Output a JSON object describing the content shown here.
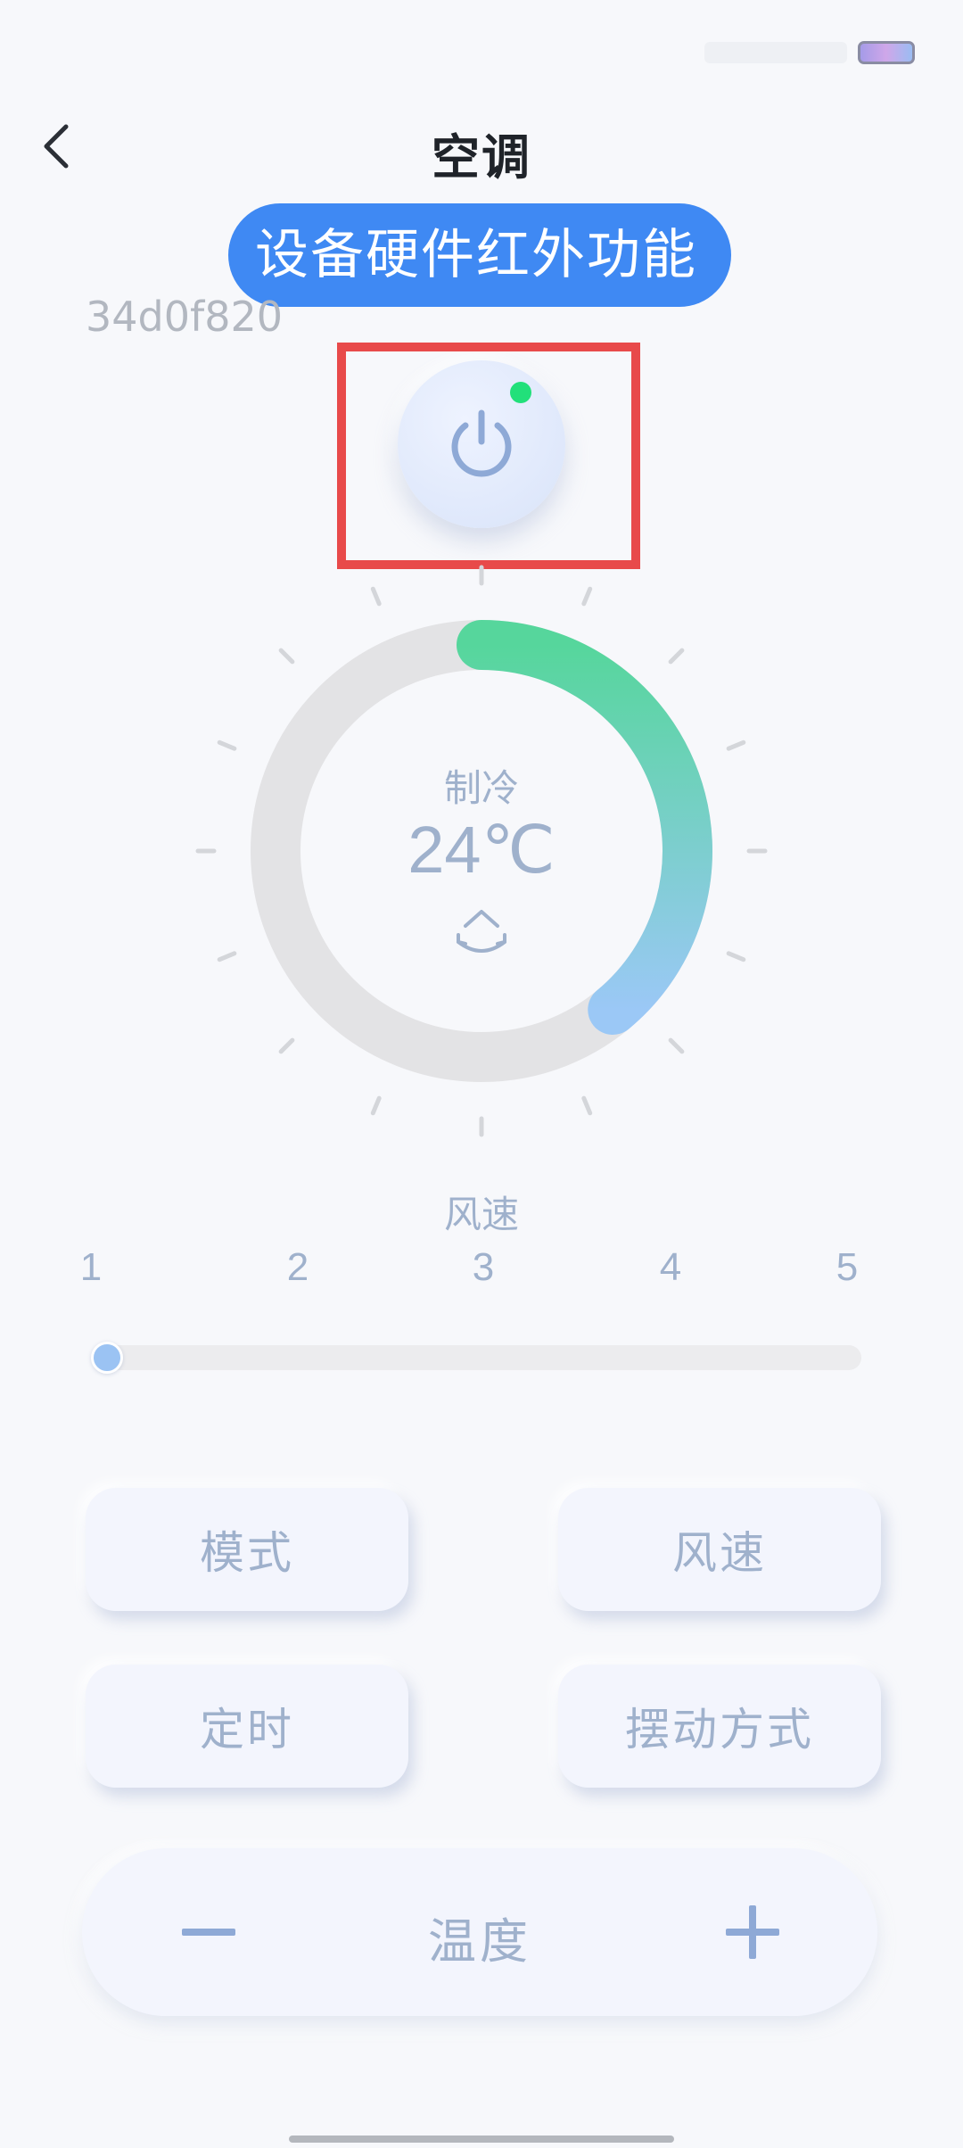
{
  "header": {
    "title": "空调"
  },
  "toast": {
    "text": "设备硬件红外功能"
  },
  "device": {
    "id": "34d0f820",
    "power_on": true
  },
  "dial": {
    "mode": "制冷",
    "temperature": "24℃",
    "arc_fraction": 0.39
  },
  "fan": {
    "title": "风速",
    "levels": [
      "1",
      "2",
      "3",
      "4",
      "5"
    ],
    "current_level": 1
  },
  "buttons": {
    "mode": "模式",
    "fan_speed": "风速",
    "timer": "定时",
    "swing": "摆动方式"
  },
  "temperature_control": {
    "label": "温度"
  },
  "colors": {
    "accent_blue": "#3f89f3",
    "arc_green": "#56d69c",
    "arc_blue": "#9bc8f6",
    "highlight_red": "#e84a4a",
    "power_indicator": "#22e07a",
    "muted_text": "#9fb1cc"
  },
  "icons": {
    "back": "chevron-left-icon",
    "power": "power-icon",
    "swing": "swing-arrows-icon",
    "minus": "minus-icon",
    "plus": "plus-icon"
  }
}
